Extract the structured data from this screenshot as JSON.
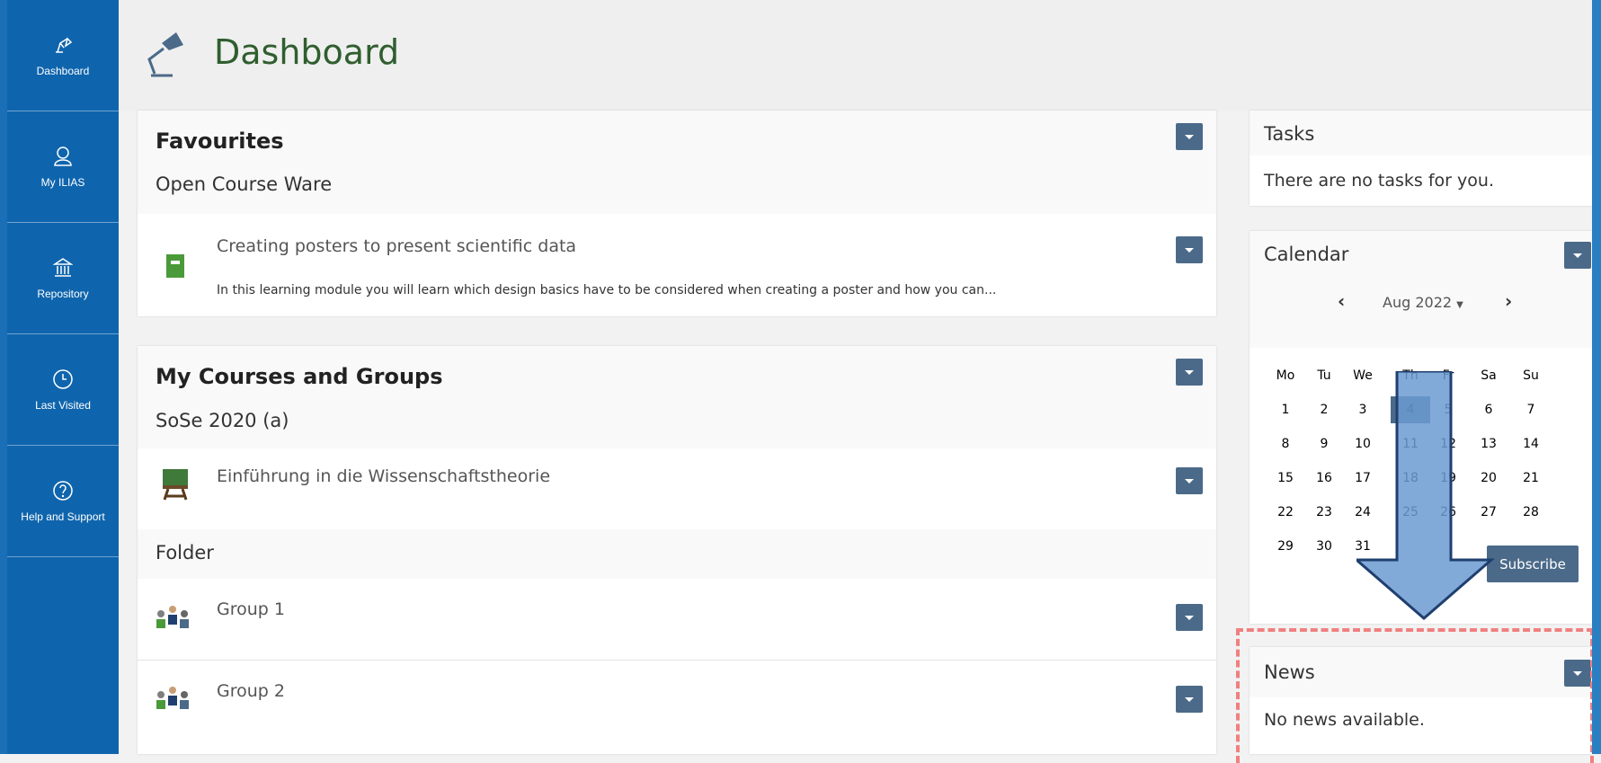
{
  "sidebar": {
    "items": [
      {
        "label": "Dashboard",
        "icon": "dashboard-icon"
      },
      {
        "label": "My ILIAS",
        "icon": "user-icon"
      },
      {
        "label": "Repository",
        "icon": "repository-icon"
      },
      {
        "label": "Last Visited",
        "icon": "clock-icon"
      },
      {
        "label": "Help and Support",
        "icon": "help-icon"
      }
    ]
  },
  "header": {
    "title": "Dashboard"
  },
  "favourites": {
    "title": "Favourites",
    "group": "Open Course Ware",
    "item_title": "Creating posters to present scientific data",
    "item_desc": "In this learning module you will learn which design basics have to be considered when creating a poster and how you can..."
  },
  "courses": {
    "title": "My Courses and Groups",
    "group1": "SoSe 2020 (a)",
    "course_title": "Einführung in die Wissenschaftstheorie",
    "group2": "Folder",
    "items": [
      "Group 1",
      "Group 2"
    ]
  },
  "tasks": {
    "title": "Tasks",
    "empty": "There are no tasks for you."
  },
  "calendar": {
    "title": "Calendar",
    "month": "Aug 2022",
    "weekdays": [
      "Mo",
      "Tu",
      "We",
      "Th",
      "Fr",
      "Sa",
      "Su"
    ],
    "weeks": [
      [
        "1",
        "2",
        "3",
        "4",
        "5",
        "6",
        "7"
      ],
      [
        "8",
        "9",
        "10",
        "11",
        "12",
        "13",
        "14"
      ],
      [
        "15",
        "16",
        "17",
        "18",
        "19",
        "20",
        "21"
      ],
      [
        "22",
        "23",
        "24",
        "25",
        "26",
        "27",
        "28"
      ],
      [
        "29",
        "30",
        "31",
        "",
        "",
        "",
        ""
      ]
    ],
    "today": "4",
    "subscribe": "Subscribe"
  },
  "news": {
    "title": "News",
    "empty": "No news available."
  },
  "colors": {
    "sidebar": "#0f65ad",
    "accent_btn": "#4b6a89",
    "title_green": "#2f5e2e",
    "highlight_border": "#f08080",
    "arrow_fill": "#6c9bd2"
  }
}
